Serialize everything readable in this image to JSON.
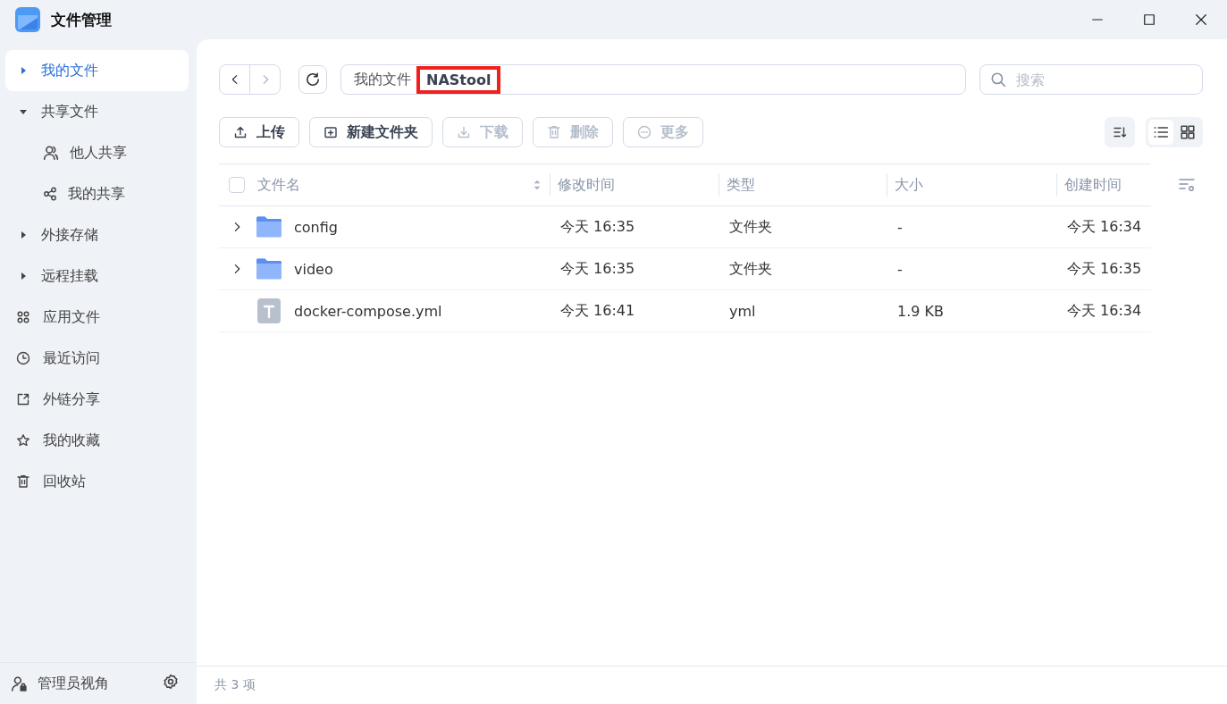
{
  "window": {
    "title": "文件管理"
  },
  "sidebar": {
    "items": [
      {
        "label": "我的文件",
        "kind": "tree",
        "selected": true,
        "expanded": false
      },
      {
        "label": "共享文件",
        "kind": "tree",
        "selected": false,
        "expanded": true,
        "children": [
          {
            "label": "他人共享",
            "selected": false
          },
          {
            "label": "我的共享",
            "selected": false
          }
        ]
      },
      {
        "label": "外接存储",
        "kind": "tree",
        "selected": false,
        "expanded": false
      },
      {
        "label": "远程挂载",
        "kind": "tree",
        "selected": false,
        "expanded": false
      },
      {
        "label": "应用文件",
        "kind": "link",
        "selected": false
      },
      {
        "label": "最近访问",
        "kind": "link",
        "selected": false
      },
      {
        "label": "外链分享",
        "kind": "link",
        "selected": false
      },
      {
        "label": "我的收藏",
        "kind": "link",
        "selected": false
      },
      {
        "label": "回收站",
        "kind": "link",
        "selected": false
      }
    ],
    "footer": {
      "label": "管理员视角"
    }
  },
  "breadcrumb": [
    {
      "label": "我的文件",
      "highlighted": false
    },
    {
      "label": "NAStool",
      "highlighted": true
    }
  ],
  "search": {
    "placeholder": "搜索"
  },
  "toolbar": [
    {
      "label": "上传",
      "disabled": false
    },
    {
      "label": "新建文件夹",
      "disabled": false
    },
    {
      "label": "下载",
      "disabled": true
    },
    {
      "label": "删除",
      "disabled": true
    },
    {
      "label": "更多",
      "disabled": true
    }
  ],
  "view_modes": [
    {
      "kind": "list",
      "selected": true
    },
    {
      "kind": "grid",
      "selected": false
    }
  ],
  "table": {
    "select_all_checked": false,
    "columns": [
      "文件名",
      "修改时间",
      "类型",
      "大小",
      "创建时间"
    ],
    "rows": [
      {
        "kind": "folder",
        "cells": [
          "config",
          "今天 16:35",
          "文件夹",
          "-",
          "今天 16:34"
        ]
      },
      {
        "kind": "folder",
        "cells": [
          "video",
          "今天 16:35",
          "文件夹",
          "-",
          "今天 16:35"
        ]
      },
      {
        "kind": "file",
        "cells": [
          "docker-compose.yml",
          "今天 16:41",
          "yml",
          "1.9 KB",
          "今天 16:34"
        ]
      }
    ]
  },
  "status_bar": "共 3 项"
}
